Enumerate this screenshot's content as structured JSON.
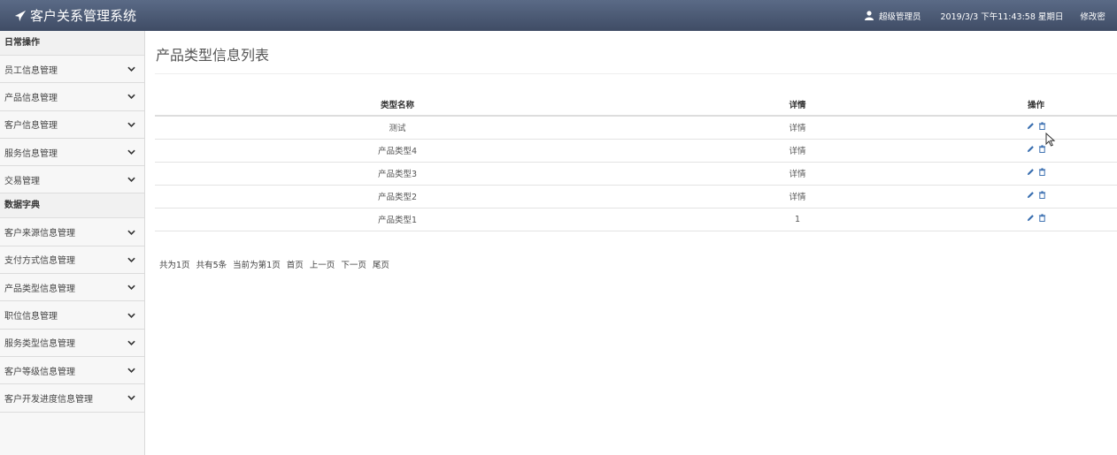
{
  "header": {
    "app_title": "客户关系管理系统",
    "user_name": "超级管理员",
    "datetime": "2019/3/3 下午11:43:58 星期日",
    "change_link": "修改密"
  },
  "sidebar": {
    "groups": [
      {
        "label": "日常操作",
        "items": [
          "员工信息管理",
          "产品信息管理",
          "客户信息管理",
          "服务信息管理",
          "交易管理"
        ]
      },
      {
        "label": "数据字典",
        "items": [
          "客户来源信息管理",
          "支付方式信息管理",
          "产品类型信息管理",
          "职位信息管理",
          "服务类型信息管理",
          "客户等级信息管理",
          "客户开发进度信息管理"
        ]
      }
    ]
  },
  "main": {
    "title": "产品类型信息列表",
    "table": {
      "headers": [
        "类型名称",
        "详情",
        "操作"
      ],
      "rows": [
        {
          "name": "测试",
          "detail": "详情"
        },
        {
          "name": "产品类型4",
          "detail": "详情"
        },
        {
          "name": "产品类型3",
          "detail": "详情"
        },
        {
          "name": "产品类型2",
          "detail": "详情"
        },
        {
          "name": "产品类型1",
          "detail": "1"
        }
      ]
    },
    "pager": {
      "total_pages": "共为1页",
      "total_records": "共有5条",
      "current": "当前为第1页",
      "first": "首页",
      "prev": "上一页",
      "next": "下一页",
      "last": "尾页"
    }
  },
  "icons": {
    "edit": "pencil-icon",
    "delete": "trash-icon",
    "user": "user-icon",
    "brand": "paper-plane-icon",
    "expand": "chevron-down-icon"
  },
  "colors": {
    "header_bg": "#4b5874",
    "link_blue": "#3a6fb0"
  }
}
